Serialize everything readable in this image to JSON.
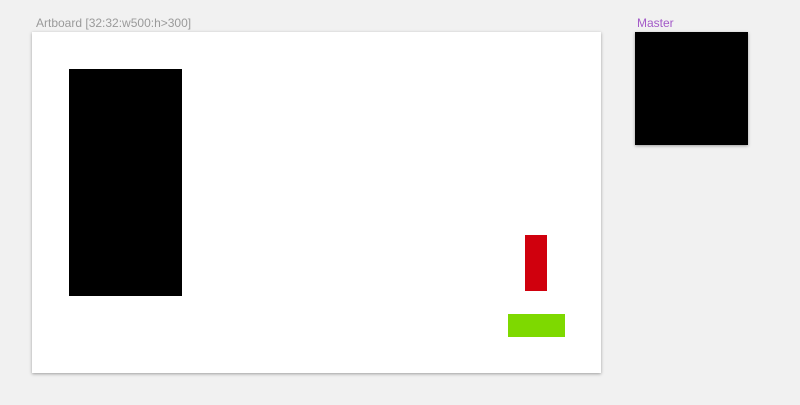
{
  "artboard": {
    "label": "Artboard [32:32:w500:h>300]",
    "label_color": "#9a9a9a",
    "background": "#ffffff",
    "shapes": [
      {
        "name": "black-rectangle",
        "color": "#000000"
      },
      {
        "name": "red-rectangle",
        "color": "#d0000d"
      },
      {
        "name": "green-rectangle",
        "color": "#7ed900"
      }
    ]
  },
  "master": {
    "label": "Master",
    "label_color": "#a35ac8",
    "background": "#000000"
  },
  "canvas": {
    "background": "#f1f1f1"
  }
}
